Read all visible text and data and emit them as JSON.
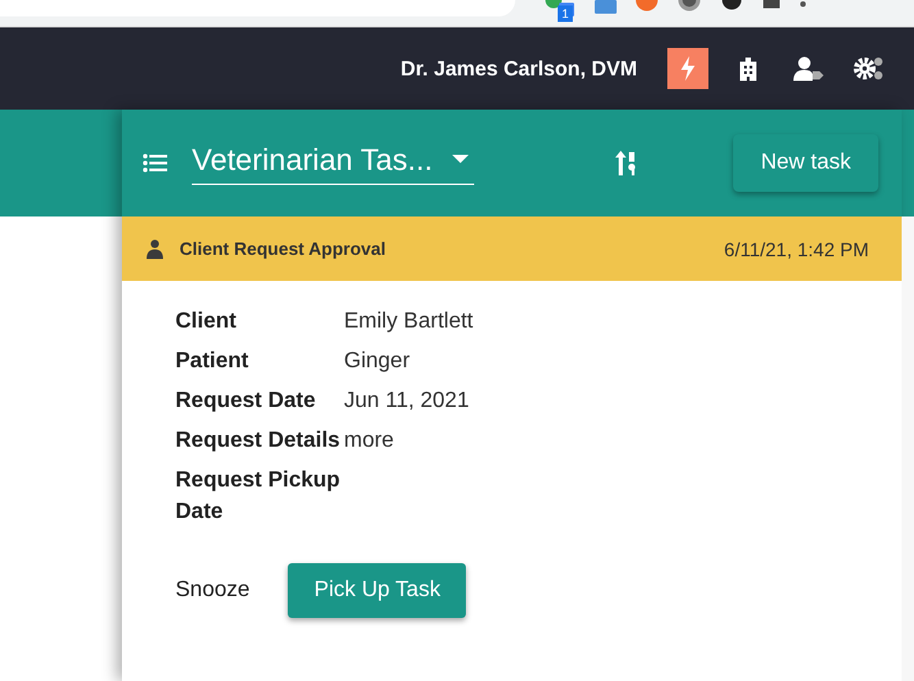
{
  "header": {
    "user_name": "Dr. James Carlson, DVM",
    "icons": [
      {
        "kind": "bolt",
        "selected": true
      },
      {
        "kind": "building",
        "selected": false
      },
      {
        "kind": "user-tag",
        "selected": false
      },
      {
        "kind": "gears",
        "selected": false
      }
    ]
  },
  "browser_toolbar": {
    "badge": "1"
  },
  "task_panel": {
    "list_title": "Veterinarian Tas...",
    "new_task_button": "New task",
    "task": {
      "type": "Client Request Approval",
      "timestamp": "6/11/21, 1:42 PM",
      "fields": [
        {
          "label": "Client",
          "value": "Emily Bartlett"
        },
        {
          "label": "Patient",
          "value": "Ginger"
        },
        {
          "label": "Request Date",
          "value": "Jun 11, 2021"
        },
        {
          "label": "Request Details",
          "value": "more"
        },
        {
          "label": "Request Pickup Date"
        }
      ],
      "actions": [
        {
          "label": "Snooze",
          "kind": "text"
        },
        {
          "label": "Pick Up Task",
          "kind": "primary"
        }
      ]
    }
  }
}
